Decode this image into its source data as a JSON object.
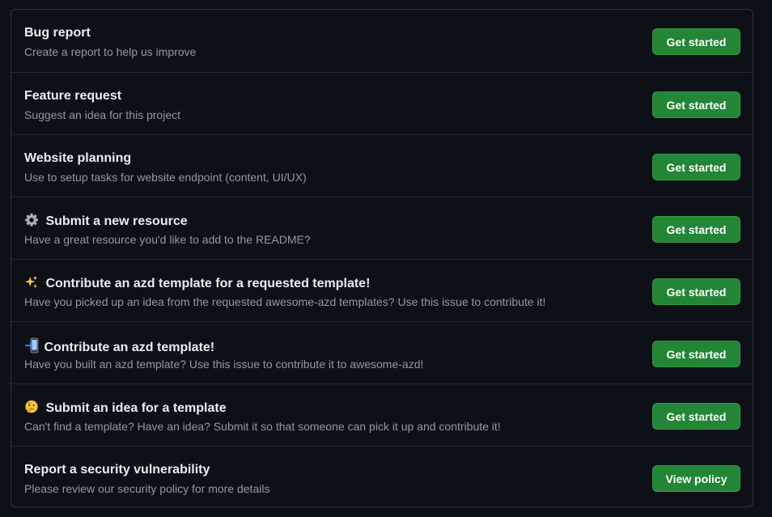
{
  "templates": [
    {
      "title": "Bug report",
      "description": "Create a report to help us improve",
      "button": "Get started"
    },
    {
      "title": "Feature request",
      "description": "Suggest an idea for this project",
      "button": "Get started"
    },
    {
      "title": "Website planning",
      "description": "Use to setup tasks for website endpoint (content, UI/UX)",
      "button": "Get started"
    },
    {
      "icon": "gear-emoji",
      "title": "Submit a new resource",
      "description": "Have a great resource you'd like to add to the README?",
      "button": "Get started"
    },
    {
      "icon": "sparkles-emoji",
      "title": "Contribute an azd template for a requested template!",
      "description": "Have you picked up an idea from the requested awesome-azd templates? Use this issue to contribute it!",
      "button": "Get started"
    },
    {
      "icon": "mobile-phone-arrow-emoji",
      "title": "Contribute an azd template!",
      "description": "Have you built an azd template? Use this issue to contribute it to awesome-azd!",
      "button": "Get started"
    },
    {
      "icon": "thinking-face-emoji",
      "title": "Submit an idea for a template",
      "description": "Can't find a template? Have an idea? Submit it so that someone can pick it up and contribute it!",
      "button": "Get started"
    },
    {
      "title": "Report a security vulnerability",
      "description": "Please review our security policy for more details",
      "button": "View policy"
    }
  ],
  "colors": {
    "background": "#0d1117",
    "border": "#30363d",
    "title": "#e6edf3",
    "description": "#9198a1",
    "button": "#238636"
  }
}
